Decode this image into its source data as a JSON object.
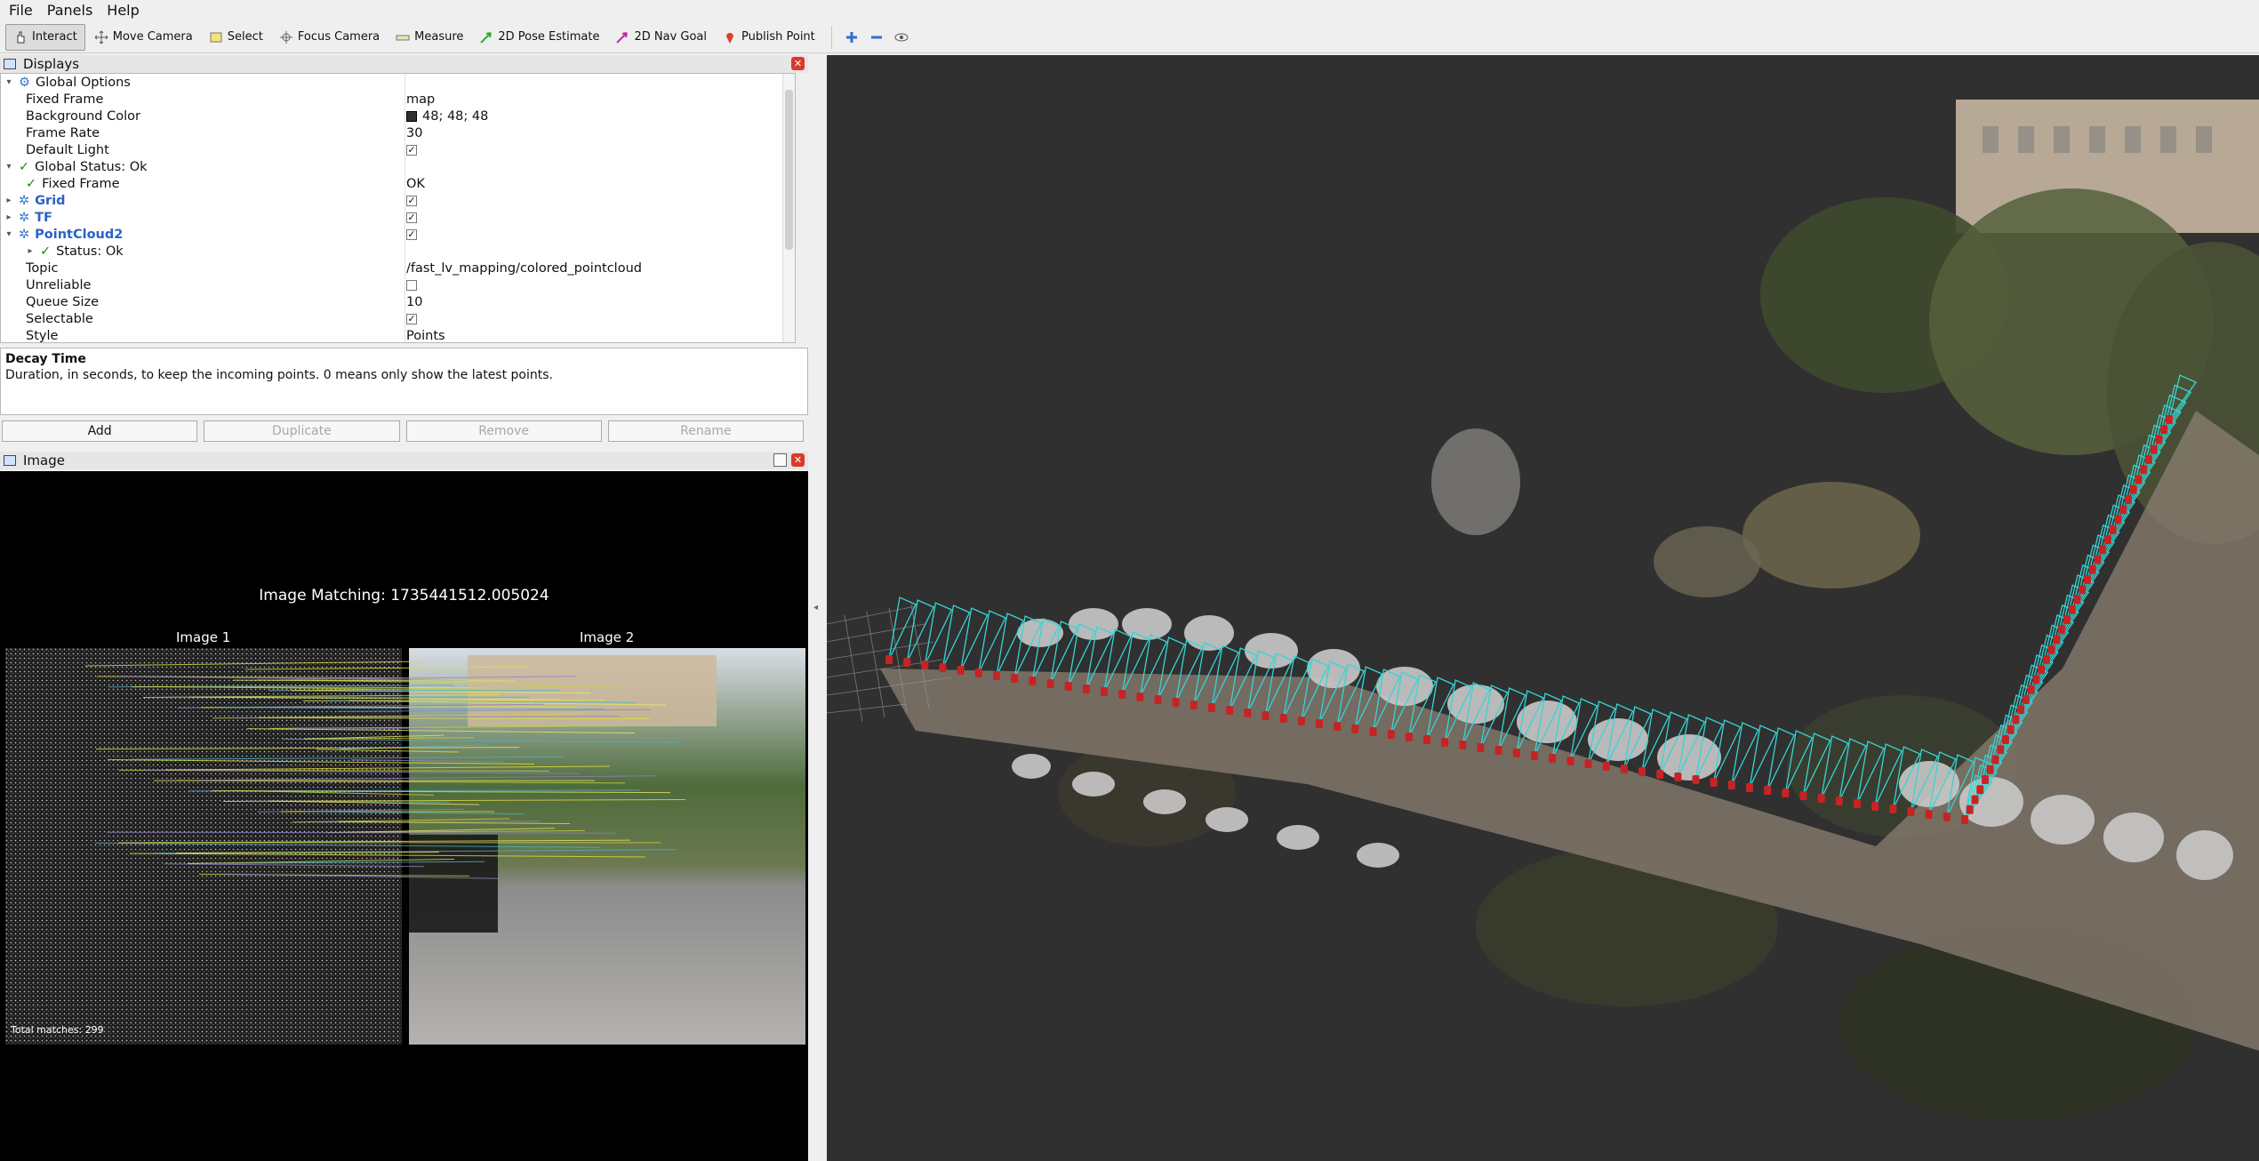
{
  "menubar": {
    "items": [
      {
        "label": "File"
      },
      {
        "label": "Panels"
      },
      {
        "label": "Help"
      }
    ]
  },
  "toolbar": {
    "tools": [
      {
        "label": "Interact",
        "icon": "hand-cursor-icon",
        "active": true
      },
      {
        "label": "Move Camera",
        "icon": "move-camera-icon"
      },
      {
        "label": "Select",
        "icon": "select-box-icon"
      },
      {
        "label": "Focus Camera",
        "icon": "crosshair-icon"
      },
      {
        "label": "Measure",
        "icon": "ruler-icon"
      },
      {
        "label": "2D Pose Estimate",
        "icon": "green-arrow-icon"
      },
      {
        "label": "2D Nav Goal",
        "icon": "magenta-arrow-icon"
      },
      {
        "label": "Publish Point",
        "icon": "map-pin-icon"
      }
    ]
  },
  "displays": {
    "title": "Displays",
    "rows": [
      {
        "label": "Global Options",
        "value": "",
        "indent": 1,
        "arrow": "▾",
        "icon": "gear-icon"
      },
      {
        "label": "Fixed Frame",
        "value": "map",
        "indent": 2
      },
      {
        "label": "Background Color",
        "value": "48; 48; 48",
        "indent": 2,
        "swatch": true
      },
      {
        "label": "Frame Rate",
        "value": "30",
        "indent": 2
      },
      {
        "label": "Default Light",
        "value": "",
        "indent": 2,
        "checkbox": true
      },
      {
        "label": "Global Status: Ok",
        "value": "",
        "indent": 1,
        "arrow": "▾",
        "check": true
      },
      {
        "label": "Fixed Frame",
        "value": "OK",
        "indent": 2,
        "check": true
      },
      {
        "label": "Grid",
        "value": "",
        "indent": 1,
        "arrow": "▸",
        "blue": true,
        "checkbox": true
      },
      {
        "label": "TF",
        "value": "",
        "indent": 1,
        "arrow": "▸",
        "blue": true,
        "checkbox": true
      },
      {
        "label": "PointCloud2",
        "value": "",
        "indent": 1,
        "arrow": "▾",
        "blue": true,
        "checkbox": true
      },
      {
        "label": "Status: Ok",
        "value": "",
        "indent": 2,
        "arrow": "▸",
        "check": true
      },
      {
        "label": "Topic",
        "value": "/fast_lv_mapping/colored_pointcloud",
        "indent": 2
      },
      {
        "label": "Unreliable",
        "value": "",
        "indent": 2,
        "checkbox_empty": true
      },
      {
        "label": "Queue Size",
        "value": "10",
        "indent": 2
      },
      {
        "label": "Selectable",
        "value": "",
        "indent": 2,
        "checkbox": true
      },
      {
        "label": "Style",
        "value": "Points",
        "indent": 2
      }
    ]
  },
  "description": {
    "title": "Decay Time",
    "text": "Duration, in seconds, to keep the incoming points. 0 means only show the latest points."
  },
  "buttons": {
    "add": "Add",
    "duplicate": "Duplicate",
    "remove": "Remove",
    "rename": "Rename"
  },
  "image_panel": {
    "title": "Image",
    "heading": "Image Matching: 1735441512.005024",
    "label_1": "Image 1",
    "label_2": "Image 2",
    "total_matches": "Total matches: 299"
  },
  "colors": {
    "background": "#303030",
    "trajectory_cyan": "#35d6d6",
    "pose_red": "#c62424"
  }
}
